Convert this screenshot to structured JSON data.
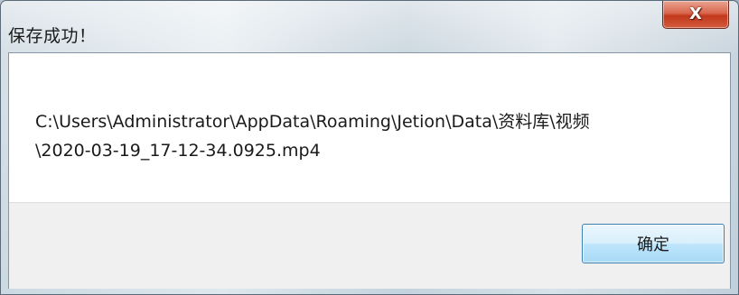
{
  "dialog": {
    "title": "保存成功！",
    "close_label": "X",
    "message": "C:\\Users\\Administrator\\AppData\\Roaming\\Jetion\\Data\\资料库\\视频\n\\2020-03-19_17-12-34.0925.mp4",
    "ok_label": "确定"
  },
  "colors": {
    "close_button": "#c84a2e",
    "ok_button_border": "#3c7fb1",
    "button_area": "#f0f0f0",
    "message_area": "#ffffff"
  }
}
